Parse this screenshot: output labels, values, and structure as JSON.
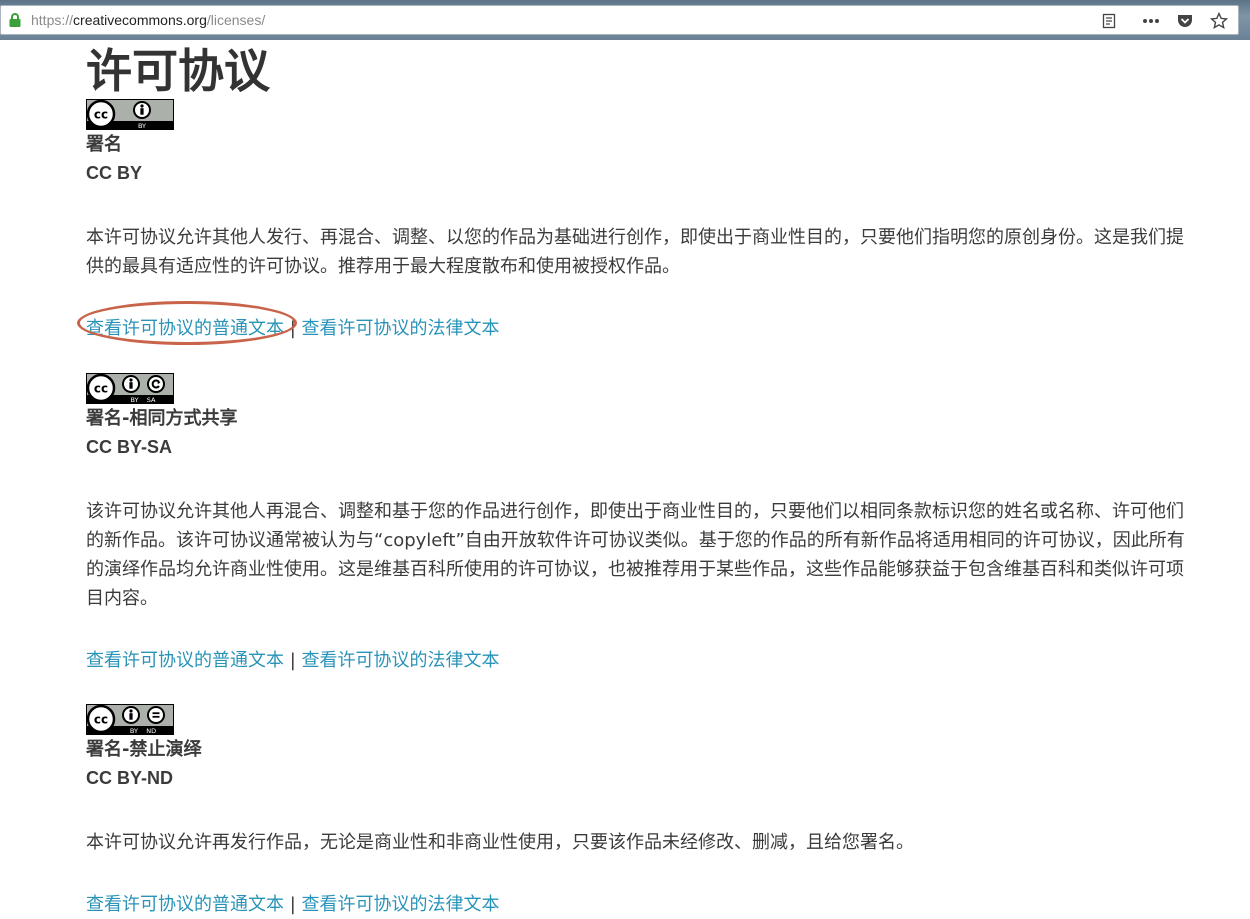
{
  "browser": {
    "url_scheme": "https://",
    "url_host": "creativecommons.org",
    "url_path": "/licenses/",
    "icons": [
      "lock-icon",
      "reader-view-icon",
      "more-actions-icon",
      "pocket-icon",
      "bookmark-star-icon"
    ]
  },
  "page": {
    "title": "许可协议",
    "separator": " | "
  },
  "licenses": [
    {
      "name": "署名",
      "code": "CC BY",
      "badge_text": "BY",
      "description": "本许可协议允许其他人发行、再混合、调整、以您的作品为基础进行创作，即使出于商业性目的，只要他们指明您的原创身份。这是我们提供的最具有适应性的许可协议。推荐用于最大程度散布和使用被授权作品。",
      "deed_link": "查看许可协议的普通文本",
      "legal_link": "查看许可协议的法律文本"
    },
    {
      "name": "署名-相同方式共享",
      "code": "CC BY-SA",
      "badge_text": "BY    SA",
      "description": "该许可协议允许其他人再混合、调整和基于您的作品进行创作，即使出于商业性目的，只要他们以相同条款标识您的姓名或名称、许可他们的新作品。该许可协议通常被认为与“copyleft”自由开放软件许可协议类似。基于您的作品的所有新作品将适用相同的许可协议，因此所有的演绎作品均允许商业性使用。这是维基百科所使用的许可协议，也被推荐用于某些作品，这些作品能够获益于包含维基百科和类似许可项目内容。",
      "deed_link": "查看许可协议的普通文本",
      "legal_link": "查看许可协议的法律文本"
    },
    {
      "name": "署名-禁止演绎",
      "code": "CC BY-ND",
      "badge_text": "BY    ND",
      "description": "本许可协议允许再发行作品，无论是商业性和非商业性使用，只要该作品未经修改、删减，且给您署名。",
      "deed_link": "查看许可协议的普通文本",
      "legal_link": "查看许可协议的法律文本"
    }
  ],
  "colors": {
    "link": "#2a93b8",
    "text": "#3b3b3b",
    "annotation_circle": "#c9644a",
    "lock": "#3aa13a"
  }
}
